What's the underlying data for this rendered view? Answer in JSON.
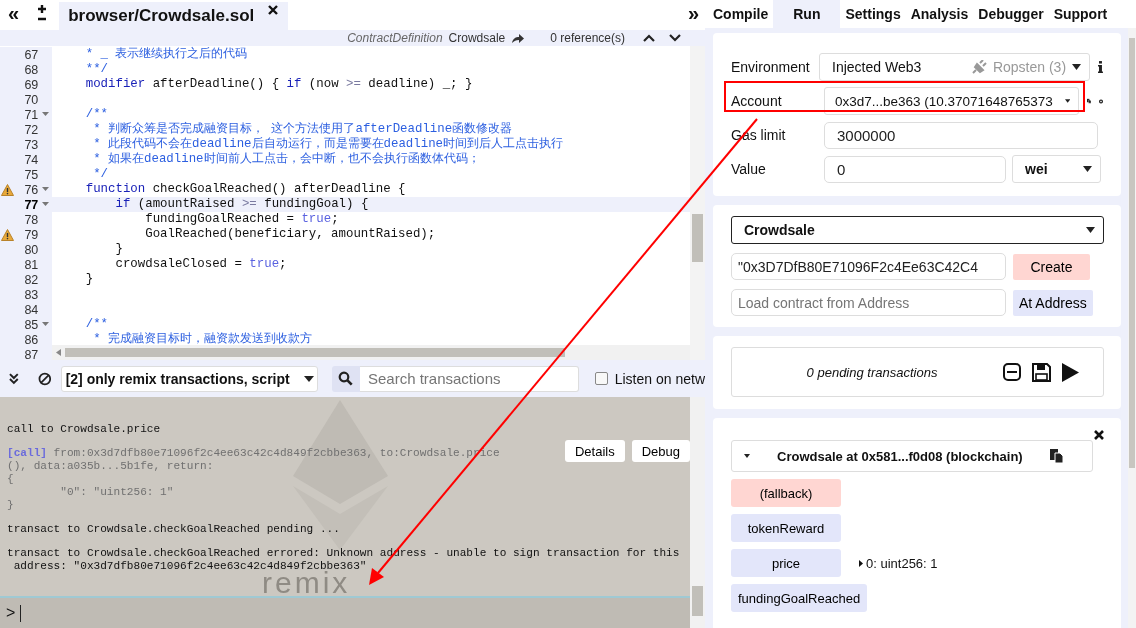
{
  "editor": {
    "collapse": "«",
    "expand": "»",
    "file_tabs": [
      {
        "label": "browser/Crowdsale.sol",
        "selected": true
      }
    ],
    "context_bar": {
      "kind_label": "ContractDefinition",
      "name": "Crowdsale",
      "references": "0 reference(s)"
    },
    "code_lines": [
      {
        "number": "67",
        "fold": false,
        "warning": false,
        "current": false,
        "tokens": [
          {
            "kind": "comment",
            "text": "    * _ 表示继续执行之后的代码"
          }
        ]
      },
      {
        "number": "68",
        "fold": false,
        "warning": false,
        "current": false,
        "tokens": [
          {
            "kind": "comment",
            "text": "    **/"
          }
        ]
      },
      {
        "number": "69",
        "fold": false,
        "warning": false,
        "current": false,
        "tokens": [
          {
            "kind": "keyword",
            "text": "    modifier"
          },
          {
            "kind": "plain",
            "text": " afterDeadline() { "
          },
          {
            "kind": "keyword",
            "text": "if"
          },
          {
            "kind": "plain",
            "text": " (now "
          },
          {
            "kind": "operator",
            "text": ">="
          },
          {
            "kind": "plain",
            "text": " deadline) _; }"
          }
        ]
      },
      {
        "number": "70",
        "fold": false,
        "warning": false,
        "current": false
      },
      {
        "number": "71",
        "fold": true,
        "warning": false,
        "current": false,
        "tokens": [
          {
            "kind": "comment",
            "text": "    /**"
          }
        ]
      },
      {
        "number": "72",
        "fold": false,
        "warning": false,
        "current": false,
        "tokens": [
          {
            "kind": "comment",
            "text": "     * 判断众筹是否完成融资目标， 这个方法使用了afterDeadline函数修改器"
          }
        ]
      },
      {
        "number": "73",
        "fold": false,
        "warning": false,
        "current": false,
        "tokens": [
          {
            "kind": "comment",
            "text": "     * 此段代码不会在deadline后自动运行，而是需要在deadline时间到后人工点击执行"
          }
        ]
      },
      {
        "number": "74",
        "fold": false,
        "warning": false,
        "current": false,
        "tokens": [
          {
            "kind": "comment",
            "text": "     * 如果在deadline时间前人工点击，会中断，也不会执行函数体代码；"
          }
        ]
      },
      {
        "number": "75",
        "fold": false,
        "warning": false,
        "current": false,
        "tokens": [
          {
            "kind": "comment",
            "text": "     */"
          }
        ]
      },
      {
        "number": "76",
        "fold": true,
        "warning": true,
        "current": false,
        "tokens": [
          {
            "kind": "keyword",
            "text": "    function"
          },
          {
            "kind": "plain",
            "text": " checkGoalReached() afterDeadline {"
          }
        ]
      },
      {
        "number": "77",
        "fold": true,
        "warning": false,
        "current": true,
        "tokens": [
          {
            "kind": "keyword",
            "text": "        if"
          },
          {
            "kind": "plain",
            "text": " (amountRaised "
          },
          {
            "kind": "operator",
            "text": ">="
          },
          {
            "kind": "plain",
            "text": " fundingGoal) {"
          }
        ]
      },
      {
        "number": "78",
        "fold": false,
        "warning": false,
        "current": false,
        "tokens": [
          {
            "kind": "plain",
            "text": "            fundingGoalReached = "
          },
          {
            "kind": "literal",
            "text": "true"
          },
          {
            "kind": "plain",
            "text": ";"
          }
        ]
      },
      {
        "number": "79",
        "fold": false,
        "warning": true,
        "current": false,
        "tokens": [
          {
            "kind": "plain",
            "text": "            GoalReached(beneficiary, amountRaised);"
          }
        ]
      },
      {
        "number": "80",
        "fold": false,
        "warning": false,
        "current": false,
        "tokens": [
          {
            "kind": "plain",
            "text": "        }"
          }
        ]
      },
      {
        "number": "81",
        "fold": false,
        "warning": false,
        "current": false,
        "tokens": [
          {
            "kind": "plain",
            "text": "        crowdsaleClosed = "
          },
          {
            "kind": "literal",
            "text": "true"
          },
          {
            "kind": "plain",
            "text": ";"
          }
        ]
      },
      {
        "number": "82",
        "fold": false,
        "warning": false,
        "current": false,
        "tokens": [
          {
            "kind": "plain",
            "text": "    }"
          }
        ]
      },
      {
        "number": "83",
        "fold": false,
        "warning": false,
        "current": false
      },
      {
        "number": "84",
        "fold": false,
        "warning": false,
        "current": false
      },
      {
        "number": "85",
        "fold": true,
        "warning": false,
        "current": false,
        "tokens": [
          {
            "kind": "comment",
            "text": "    /**"
          }
        ]
      },
      {
        "number": "86",
        "fold": false,
        "warning": false,
        "current": false,
        "tokens": [
          {
            "kind": "comment",
            "text": "     * 完成融资目标时，融资款发送到收款方"
          }
        ]
      },
      {
        "number": "87",
        "fold": false,
        "warning": false,
        "current": false
      }
    ]
  },
  "console": {
    "filter": "[2] only remix transactions, script",
    "search_placeholder": "Search transactions",
    "listen_label": "Listen on netw",
    "listen_checked": false,
    "logo_text": "remix",
    "entries": [
      {
        "kind": "text",
        "lines": [
          "call to Crowdsale.price"
        ]
      },
      {
        "kind": "call",
        "tag": "[call]",
        "lines": [
          " from:0x3d7dfb80e71096f2c4ee63c42c4d849f2cbbe363, to:Crowdsale.price",
          "(), data:a035b...5b1fe, return:",
          "{",
          "        \"0\": \"uint256: 1\"",
          "}"
        ],
        "buttons": [
          "Details",
          "Debug"
        ]
      },
      {
        "kind": "text",
        "lines": [
          "transact to Crowdsale.checkGoalReached pending ..."
        ]
      },
      {
        "kind": "text",
        "lines": [
          "transact to Crowdsale.checkGoalReached errored: Unknown address - unable to sign transaction for this",
          " address: \"0x3d7dfb80e71096f2c4ee63c42c4d849f2cbbe363\""
        ]
      }
    ],
    "prompt": ">"
  },
  "panel": {
    "tabs": [
      {
        "label": "Compile",
        "selected": false
      },
      {
        "label": "Run",
        "selected": true
      },
      {
        "label": "Settings",
        "selected": false
      },
      {
        "label": "Analysis",
        "selected": false
      },
      {
        "label": "Debugger",
        "selected": false
      },
      {
        "label": "Support",
        "selected": false
      }
    ],
    "environment": {
      "label": "Environment",
      "value": "Injected Web3",
      "network": "Ropsten (3)"
    },
    "account": {
      "label": "Account",
      "value": "0x3d7...be363 (10.37071648765373"
    },
    "gas_limit": {
      "label": "Gas limit",
      "value": "3000000"
    },
    "value": {
      "label": "Value",
      "value": "0",
      "unit": "wei"
    },
    "contract": {
      "selected": "Crowdsale",
      "args": "\"0x3D7DfB80E71096F2c4Ee63C42C4",
      "create": "Create",
      "address_placeholder": "Load contract from Address",
      "at_address": "At Address"
    },
    "pending": "0 pending transactions",
    "instance": {
      "title": "Crowdsale at 0x581...f0d08 (blockchain)",
      "functions": [
        {
          "label": "(fallback)",
          "kind": "fallback"
        },
        {
          "label": "tokenReward",
          "kind": "call"
        },
        {
          "label": "price",
          "kind": "call",
          "result": "0: uint256: 1"
        },
        {
          "label": "fundingGoalReached",
          "kind": "call"
        }
      ]
    }
  }
}
